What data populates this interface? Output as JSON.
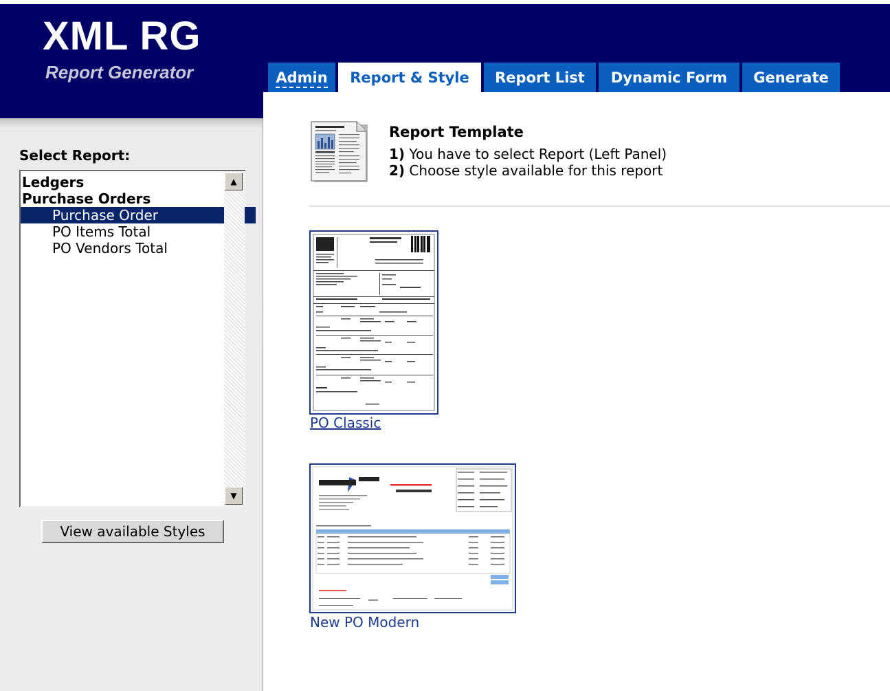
{
  "app": {
    "logo_title": "XML RG",
    "logo_subtitle": "Report Generator"
  },
  "tabs": [
    {
      "label": "Admin",
      "active": false
    },
    {
      "label": "Report & Style",
      "active": true
    },
    {
      "label": "Report List",
      "active": false
    },
    {
      "label": "Dynamic Form",
      "active": false
    },
    {
      "label": "Generate",
      "active": false
    }
  ],
  "sidebar": {
    "select_label": "Select Report:",
    "items": [
      {
        "label": "Ledgers",
        "type": "group"
      },
      {
        "label": "Purchase Orders",
        "type": "group"
      },
      {
        "label": "Purchase Order",
        "type": "child",
        "selected": true
      },
      {
        "label": "PO Items Total",
        "type": "child"
      },
      {
        "label": "PO Vendors Total",
        "type": "child"
      }
    ],
    "view_button": "View available Styles"
  },
  "main": {
    "template_title": "Report Template",
    "steps": [
      {
        "num": "1)",
        "text": "You have to select Report (Left Panel)"
      },
      {
        "num": "2)",
        "text": "Choose style available for this report"
      }
    ],
    "styles": [
      {
        "name": "PO Classic"
      },
      {
        "name": "New PO Modern"
      }
    ]
  },
  "colors": {
    "header_bg": "#000066",
    "tab_bg": "#0b5fbf",
    "selection": "#0a246a",
    "link": "#1d3c8f"
  }
}
